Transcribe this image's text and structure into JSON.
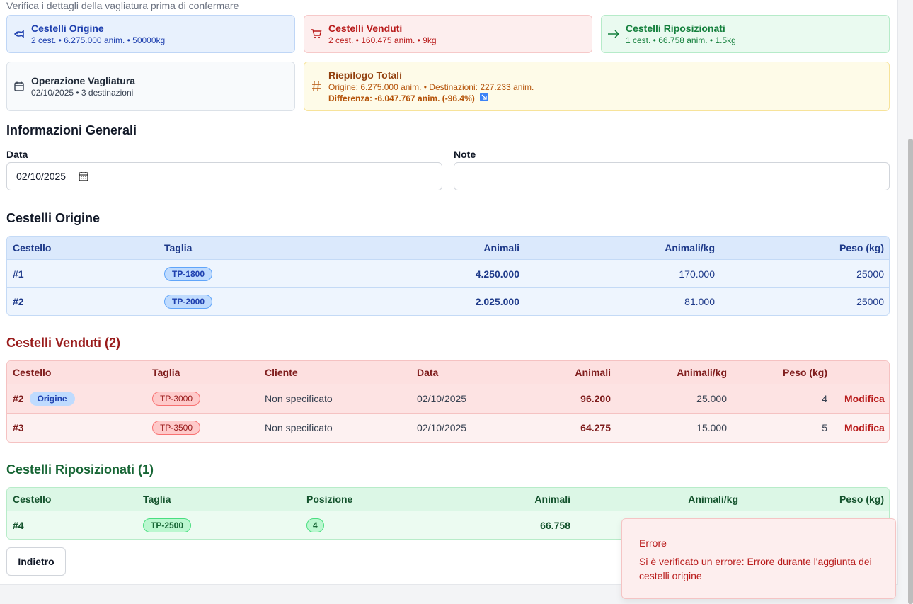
{
  "header": {
    "subtitle": "Verifica i dettagli della vagliatura prima di confermare"
  },
  "summary_cards": {
    "origin": {
      "title": "Cestelli Origine",
      "detail": "2 cest. • 6.275.000 anim. • 50000kg",
      "icon": "fish-icon"
    },
    "sold": {
      "title": "Cestelli Venduti",
      "detail": "2 cest. • 160.475 anim. • 9kg",
      "icon": "cart-icon"
    },
    "repositioned": {
      "title": "Cestelli Riposizionati",
      "detail": "1 cest. • 66.758 anim. • 1.5kg",
      "icon": "arrow-right-icon"
    },
    "operation": {
      "title": "Operazione Vagliatura",
      "detail": "02/10/2025 • 3 destinazioni",
      "icon": "calendar-icon"
    },
    "totals": {
      "title": "Riepilogo Totali",
      "line1": "Origine: 6.275.000 anim. • Destinazioni: 227.233 anim.",
      "line2": "Differenza: -6.047.767 anim. (-96.4%)",
      "icon": "hash-icon",
      "trend_icon": "trend-down-icon"
    }
  },
  "general": {
    "title": "Informazioni Generali",
    "date_label": "Data",
    "date_value": "02/10/2025",
    "notes_label": "Note",
    "notes_value": ""
  },
  "origin_table": {
    "title": "Cestelli Origine",
    "headers": [
      "Cestello",
      "Taglia",
      "Animali",
      "Animali/kg",
      "Peso (kg)"
    ],
    "rows": [
      {
        "cestello": "#1",
        "taglia": "TP-1800",
        "animali": "4.250.000",
        "animali_kg": "170.000",
        "peso": "25000"
      },
      {
        "cestello": "#2",
        "taglia": "TP-2000",
        "animali": "2.025.000",
        "animali_kg": "81.000",
        "peso": "25000"
      }
    ]
  },
  "sold_table": {
    "title": "Cestelli Venduti (2)",
    "headers": [
      "Cestello",
      "Taglia",
      "Cliente",
      "Data",
      "Animali",
      "Animali/kg",
      "Peso (kg)"
    ],
    "rows": [
      {
        "cestello": "#2",
        "badge": "Origine",
        "taglia": "TP-3000",
        "cliente": "Non specificato",
        "data": "02/10/2025",
        "animali": "96.200",
        "animali_kg": "25.000",
        "peso": "4",
        "action": "Modifica"
      },
      {
        "cestello": "#3",
        "badge": "",
        "taglia": "TP-3500",
        "cliente": "Non specificato",
        "data": "02/10/2025",
        "animali": "64.275",
        "animali_kg": "15.000",
        "peso": "5",
        "action": "Modifica"
      }
    ]
  },
  "repositioned_table": {
    "title": "Cestelli Riposizionati (1)",
    "headers": [
      "Cestello",
      "Taglia",
      "Posizione",
      "Animali",
      "Animali/kg",
      "Peso (kg)"
    ],
    "rows": [
      {
        "cestello": "#4",
        "taglia": "TP-2500",
        "posizione": "4",
        "animali": "66.758"
      }
    ]
  },
  "actions": {
    "back": "Indietro"
  },
  "toast": {
    "title": "Errore",
    "message": "Si è verificato un errore: Errore durante l'aggiunta dei cestelli origine"
  },
  "colors": {
    "blue": "#1e40af",
    "red": "#b91c1c",
    "green": "#15803d",
    "amber": "#b45309"
  }
}
